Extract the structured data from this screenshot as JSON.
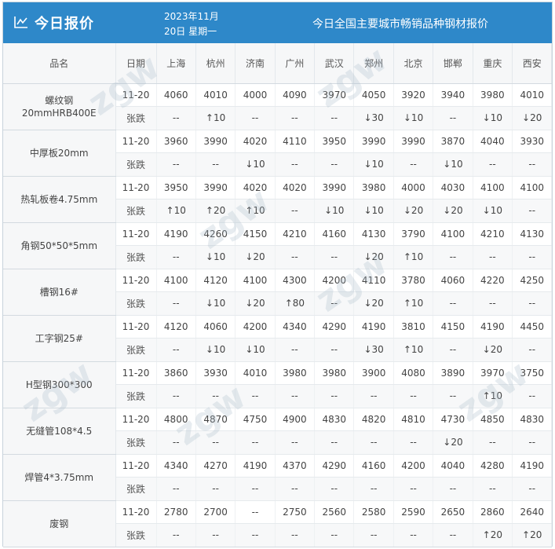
{
  "header": {
    "title": "今日报价",
    "date_line1": "2023年11月",
    "date_line2": "20日  星期一",
    "subtitle": "今日全国主要城市畅销品种钢材报价"
  },
  "table": {
    "col_product": "品名",
    "col_date": "日期",
    "cities": [
      "上海",
      "杭州",
      "济南",
      "广州",
      "武汉",
      "郑州",
      "北京",
      "邯郸",
      "重庆",
      "西安"
    ],
    "change_label": "张跌",
    "rows": [
      {
        "name": "螺纹钢",
        "name2": "20mmHRB400E",
        "date": "11-20",
        "prices": [
          "4060",
          "4010",
          "4000",
          "4090",
          "3970",
          "4050",
          "3920",
          "3940",
          "3980",
          "4010"
        ],
        "changes": [
          "--",
          "↑10",
          "--",
          "--",
          "--",
          "↓30",
          "↓10",
          "--",
          "↓10",
          "↓20"
        ]
      },
      {
        "name": "中厚板20mm",
        "name2": "",
        "date": "11-20",
        "prices": [
          "3960",
          "3990",
          "4020",
          "4110",
          "3950",
          "3990",
          "3990",
          "3870",
          "4040",
          "3930"
        ],
        "changes": [
          "--",
          "--",
          "↓10",
          "--",
          "--",
          "↓10",
          "--",
          "↓10",
          "--",
          "--"
        ]
      },
      {
        "name": "热轧板卷4.75mm",
        "name2": "",
        "date": "11-20",
        "prices": [
          "3950",
          "3990",
          "4020",
          "4020",
          "3990",
          "3980",
          "4000",
          "4030",
          "4100",
          "4100"
        ],
        "changes": [
          "↑10",
          "↑20",
          "↑10",
          "--",
          "↓10",
          "↓10",
          "↓20",
          "↓20",
          "↓10",
          "--"
        ]
      },
      {
        "name": "角钢50*50*5mm",
        "name2": "",
        "date": "11-20",
        "prices": [
          "4190",
          "4260",
          "4150",
          "4210",
          "4160",
          "4130",
          "3790",
          "4100",
          "4210",
          "4130"
        ],
        "changes": [
          "--",
          "↓10",
          "↓20",
          "--",
          "--",
          "↓20",
          "↑10",
          "--",
          "--",
          "--"
        ]
      },
      {
        "name": "槽钢16#",
        "name2": "",
        "date": "11-20",
        "prices": [
          "4100",
          "4120",
          "4100",
          "4300",
          "4200",
          "4110",
          "3780",
          "4060",
          "4220",
          "4250"
        ],
        "changes": [
          "--",
          "↓10",
          "↓20",
          "↑80",
          "--",
          "↓20",
          "↑10",
          "--",
          "--",
          "--"
        ]
      },
      {
        "name": "工字钢25#",
        "name2": "",
        "date": "11-20",
        "prices": [
          "4120",
          "4060",
          "4200",
          "4340",
          "4290",
          "4190",
          "3810",
          "4150",
          "4190",
          "4450"
        ],
        "changes": [
          "--",
          "↓10",
          "↓10",
          "--",
          "--",
          "↓30",
          "↑10",
          "--",
          "↓20",
          "--"
        ]
      },
      {
        "name": "H型钢300*300",
        "name2": "",
        "date": "11-20",
        "prices": [
          "3860",
          "3930",
          "4010",
          "3980",
          "3980",
          "3900",
          "4080",
          "3890",
          "3970",
          "3750"
        ],
        "changes": [
          "--",
          "--",
          "--",
          "--",
          "--",
          "--",
          "--",
          "--",
          "↑10",
          "--"
        ]
      },
      {
        "name": "无缝管108*4.5",
        "name2": "",
        "date": "11-20",
        "prices": [
          "4800",
          "4870",
          "4750",
          "4900",
          "4830",
          "4820",
          "4810",
          "4730",
          "4850",
          "4830"
        ],
        "changes": [
          "--",
          "--",
          "--",
          "--",
          "--",
          "--",
          "--",
          "↓20",
          "--",
          "--"
        ]
      },
      {
        "name": "焊管4*3.75mm",
        "name2": "",
        "date": "11-20",
        "prices": [
          "4340",
          "4270",
          "4190",
          "4370",
          "4290",
          "4160",
          "4200",
          "4040",
          "4280",
          "4190"
        ],
        "changes": [
          "--",
          "--",
          "--",
          "--",
          "--",
          "--",
          "--",
          "--",
          "--",
          "--"
        ]
      },
      {
        "name": "废钢",
        "name2": "",
        "date": "11-20",
        "prices": [
          "2780",
          "2700",
          "--",
          "2750",
          "2560",
          "2580",
          "2590",
          "2650",
          "2860",
          "2640"
        ],
        "changes": [
          "--",
          "--",
          "--",
          "--",
          "--",
          "--",
          "--",
          "--",
          "↑20",
          "↑20"
        ]
      }
    ]
  },
  "colors": {
    "header_bg": "#2e88c9",
    "up": "#e02020",
    "down": "#2eaa2e"
  },
  "icons": {
    "header": "line-chart-icon"
  }
}
